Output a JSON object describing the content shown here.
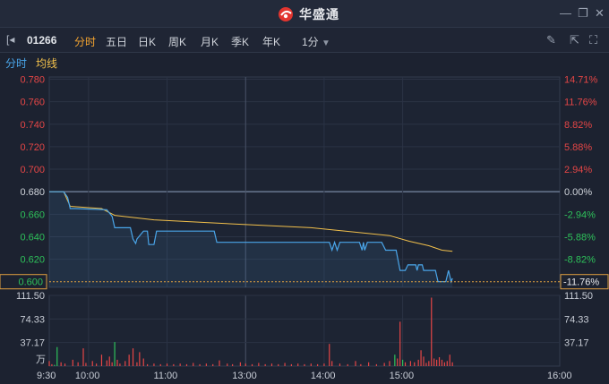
{
  "app": {
    "brand": "华盛通"
  },
  "toolbar": {
    "stock_code": "01266",
    "tabs": [
      "分时",
      "五日",
      "日K",
      "周K",
      "月K",
      "季K",
      "年K"
    ],
    "active_tab": 0,
    "period": "1分"
  },
  "legend": {
    "price": "分时",
    "avg": "均线"
  },
  "colors": {
    "up": "#e54646",
    "down": "#2ec15a",
    "price_line": "#4aa6ea",
    "avg_line": "#f2c04b",
    "prev_close": "#8ea0bd"
  },
  "chart_data": {
    "type": "line",
    "prev_close": 0.68,
    "current_price_label": "0.600",
    "current_pct_label": "-11.76%",
    "price_ticks": [
      "0.780",
      "0.760",
      "0.740",
      "0.720",
      "0.700",
      "0.680",
      "0.660",
      "0.640",
      "0.620"
    ],
    "pct_ticks": [
      "14.71%",
      "11.76%",
      "8.82%",
      "5.88%",
      "2.94%",
      "0.00%",
      "-2.94%",
      "-5.88%",
      "-8.82%"
    ],
    "volume_ticks": [
      "111.50",
      "74.33",
      "37.17"
    ],
    "volume_unit": "万",
    "time_ticks": [
      "9:30",
      "10:00",
      "11:00",
      "13:00",
      "14:00",
      "15:00",
      "16:00"
    ],
    "ylim": [
      0.595,
      0.782
    ],
    "volume_max": 111.5,
    "price_series": {
      "name": "分时",
      "points": [
        [
          0,
          0.68
        ],
        [
          11,
          0.68
        ],
        [
          14,
          0.675
        ],
        [
          16,
          0.665
        ],
        [
          20,
          0.665
        ],
        [
          44,
          0.664
        ],
        [
          48,
          0.658
        ],
        [
          50,
          0.648
        ],
        [
          62,
          0.648
        ],
        [
          64,
          0.638
        ],
        [
          66,
          0.634
        ],
        [
          67,
          0.638
        ],
        [
          72,
          0.645
        ],
        [
          75,
          0.645
        ],
        [
          76,
          0.633
        ],
        [
          80,
          0.633
        ],
        [
          82,
          0.645
        ],
        [
          126,
          0.645
        ],
        [
          128,
          0.635
        ],
        [
          214,
          0.635
        ],
        [
          216,
          0.628
        ],
        [
          218,
          0.635
        ],
        [
          220,
          0.628
        ],
        [
          222,
          0.635
        ],
        [
          237,
          0.635
        ],
        [
          239,
          0.628
        ],
        [
          240,
          0.635
        ],
        [
          241,
          0.628
        ],
        [
          243,
          0.635
        ],
        [
          254,
          0.635
        ],
        [
          257,
          0.628
        ],
        [
          265,
          0.628
        ],
        [
          268,
          0.61
        ],
        [
          272,
          0.61
        ],
        [
          274,
          0.615
        ],
        [
          280,
          0.615
        ],
        [
          281,
          0.61
        ],
        [
          282,
          0.615
        ],
        [
          285,
          0.615
        ],
        [
          286,
          0.61
        ],
        [
          295,
          0.61
        ],
        [
          297,
          0.6
        ],
        [
          303,
          0.6
        ],
        [
          305,
          0.61
        ],
        [
          307,
          0.6
        ],
        [
          308,
          0.603
        ]
      ]
    },
    "avg_series": {
      "name": "均线",
      "points": [
        [
          0,
          0.68
        ],
        [
          11,
          0.68
        ],
        [
          16,
          0.667
        ],
        [
          40,
          0.665
        ],
        [
          50,
          0.659
        ],
        [
          80,
          0.655
        ],
        [
          130,
          0.652
        ],
        [
          200,
          0.648
        ],
        [
          260,
          0.641
        ],
        [
          275,
          0.636
        ],
        [
          290,
          0.632
        ],
        [
          300,
          0.628
        ],
        [
          308,
          0.627
        ]
      ]
    },
    "volume": [
      [
        0,
        8,
        "u"
      ],
      [
        2,
        3,
        "u"
      ],
      [
        4,
        2,
        "d"
      ],
      [
        6,
        30,
        "d"
      ],
      [
        9,
        6,
        "u"
      ],
      [
        12,
        4,
        "u"
      ],
      [
        18,
        10,
        "u"
      ],
      [
        22,
        6,
        "u"
      ],
      [
        26,
        28,
        "u"
      ],
      [
        28,
        5,
        "u"
      ],
      [
        33,
        8,
        "u"
      ],
      [
        36,
        4,
        "u"
      ],
      [
        40,
        18,
        "u"
      ],
      [
        44,
        9,
        "u"
      ],
      [
        46,
        15,
        "u"
      ],
      [
        48,
        6,
        "u"
      ],
      [
        50,
        38,
        "d"
      ],
      [
        52,
        10,
        "u"
      ],
      [
        54,
        4,
        "u"
      ],
      [
        58,
        8,
        "u"
      ],
      [
        61,
        18,
        "u"
      ],
      [
        64,
        28,
        "u"
      ],
      [
        67,
        6,
        "u"
      ],
      [
        69,
        22,
        "u"
      ],
      [
        72,
        12,
        "u"
      ],
      [
        75,
        3,
        "u"
      ],
      [
        80,
        4,
        "u"
      ],
      [
        85,
        3,
        "u"
      ],
      [
        90,
        4,
        "u"
      ],
      [
        95,
        3,
        "u"
      ],
      [
        100,
        4,
        "u"
      ],
      [
        105,
        3,
        "u"
      ],
      [
        110,
        5,
        "u"
      ],
      [
        115,
        3,
        "u"
      ],
      [
        120,
        4,
        "u"
      ],
      [
        125,
        3,
        "u"
      ],
      [
        130,
        9,
        "u"
      ],
      [
        136,
        4,
        "u"
      ],
      [
        140,
        3,
        "u"
      ],
      [
        146,
        6,
        "u"
      ],
      [
        150,
        4,
        "u"
      ],
      [
        155,
        3,
        "u"
      ],
      [
        160,
        5,
        "u"
      ],
      [
        165,
        3,
        "u"
      ],
      [
        170,
        4,
        "u"
      ],
      [
        175,
        3,
        "u"
      ],
      [
        180,
        5,
        "u"
      ],
      [
        185,
        3,
        "u"
      ],
      [
        190,
        4,
        "u"
      ],
      [
        195,
        3,
        "u"
      ],
      [
        200,
        4,
        "u"
      ],
      [
        205,
        3,
        "u"
      ],
      [
        210,
        4,
        "u"
      ],
      [
        214,
        35,
        "u"
      ],
      [
        216,
        8,
        "u"
      ],
      [
        222,
        4,
        "u"
      ],
      [
        228,
        3,
        "u"
      ],
      [
        234,
        8,
        "u"
      ],
      [
        238,
        3,
        "u"
      ],
      [
        244,
        6,
        "u"
      ],
      [
        250,
        3,
        "u"
      ],
      [
        256,
        5,
        "u"
      ],
      [
        260,
        8,
        "u"
      ],
      [
        264,
        18,
        "d"
      ],
      [
        266,
        12,
        "u"
      ],
      [
        268,
        70,
        "u"
      ],
      [
        270,
        10,
        "d"
      ],
      [
        272,
        6,
        "u"
      ],
      [
        276,
        8,
        "u"
      ],
      [
        279,
        6,
        "u"
      ],
      [
        282,
        10,
        "u"
      ],
      [
        284,
        25,
        "u"
      ],
      [
        286,
        15,
        "u"
      ],
      [
        288,
        5,
        "u"
      ],
      [
        290,
        8,
        "u"
      ],
      [
        292,
        108,
        "u"
      ],
      [
        294,
        12,
        "u"
      ],
      [
        296,
        10,
        "u"
      ],
      [
        298,
        14,
        "u"
      ],
      [
        300,
        10,
        "u"
      ],
      [
        302,
        6,
        "u"
      ],
      [
        304,
        8,
        "u"
      ],
      [
        306,
        18,
        "u"
      ],
      [
        308,
        6,
        "u"
      ]
    ]
  }
}
